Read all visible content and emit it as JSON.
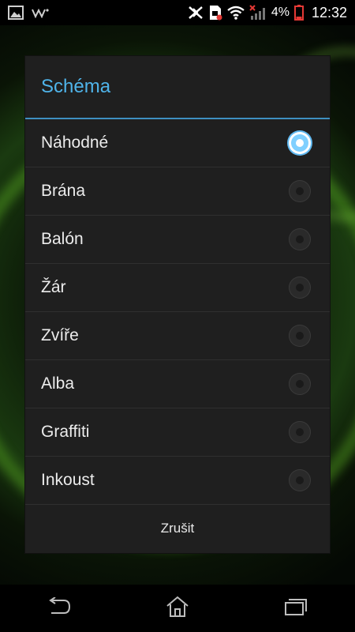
{
  "status_bar": {
    "battery_percent": "4%",
    "time": "12:32",
    "icons": [
      "gallery-icon",
      "walkman-icon",
      "bluetooth-icon",
      "sim-icon",
      "wifi-icon",
      "signal-icon",
      "battery-icon"
    ],
    "battery_color": "#e53935"
  },
  "dialog": {
    "title": "Schéma",
    "accent_color": "#4fb4ea",
    "options": [
      {
        "label": "Náhodné",
        "selected": true
      },
      {
        "label": "Brána",
        "selected": false
      },
      {
        "label": "Balón",
        "selected": false
      },
      {
        "label": "Žár",
        "selected": false
      },
      {
        "label": "Zvíře",
        "selected": false
      },
      {
        "label": "Alba",
        "selected": false
      },
      {
        "label": "Graffiti",
        "selected": false
      },
      {
        "label": "Inkoust",
        "selected": false
      }
    ],
    "cancel_label": "Zrušit"
  },
  "nav_bar": {
    "buttons": [
      "back-icon",
      "home-icon",
      "recent-apps-icon"
    ]
  }
}
